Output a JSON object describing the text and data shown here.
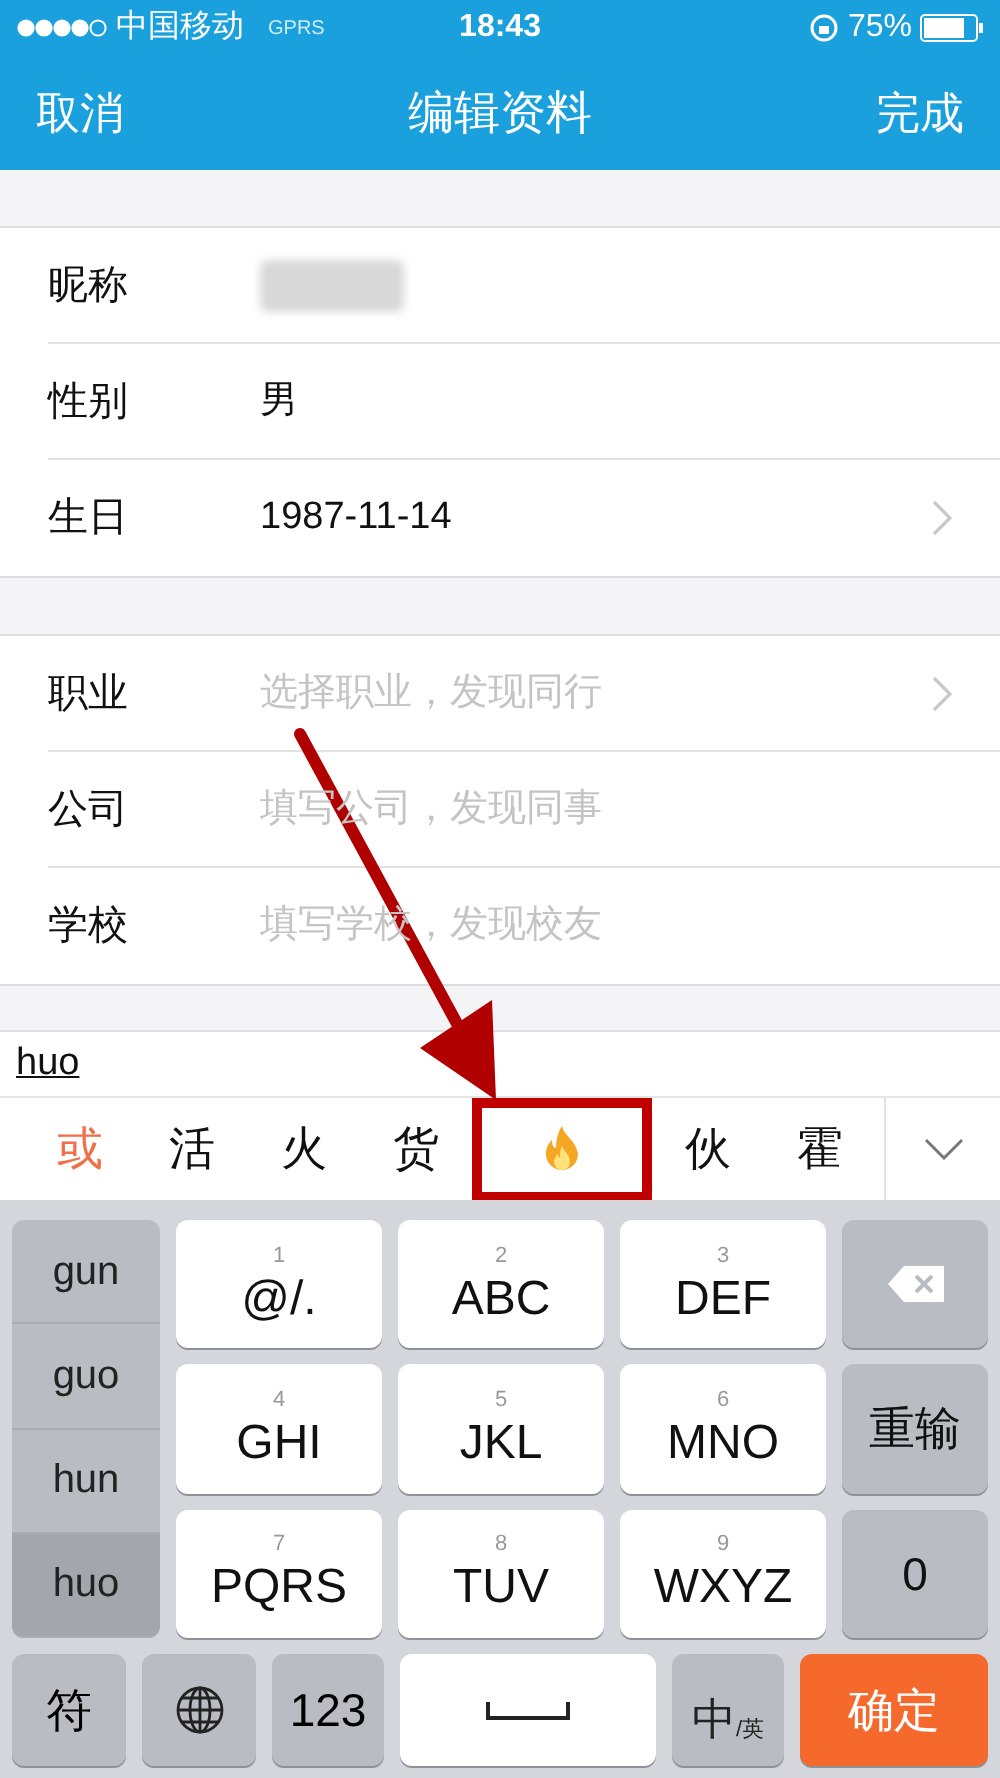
{
  "status_bar": {
    "carrier": "中国移动",
    "network": "GPRS",
    "time": "18:43",
    "battery": "75%"
  },
  "nav": {
    "left": "取消",
    "title": "编辑资料",
    "right": "完成"
  },
  "sections": [
    {
      "rows": [
        {
          "label": "昵称",
          "kind": "blurred",
          "chevron": false
        },
        {
          "label": "性别",
          "value": "男",
          "kind": "value",
          "chevron": false
        },
        {
          "label": "生日",
          "value": "1987-11-14",
          "kind": "value",
          "chevron": true
        }
      ]
    },
    {
      "rows": [
        {
          "label": "职业",
          "placeholder": "选择职业，发现同行",
          "kind": "field",
          "chevron": true
        },
        {
          "label": "公司",
          "placeholder": "填写公司，发现同事",
          "kind": "field",
          "chevron": false
        },
        {
          "label": "学校",
          "placeholder": "填写学校，发现校友",
          "kind": "field",
          "chevron": false
        }
      ]
    }
  ],
  "ime": {
    "composition": "huo",
    "candidates": [
      {
        "text": "或",
        "selected": true,
        "highlighted": false,
        "kind": "text"
      },
      {
        "text": "活",
        "selected": false,
        "highlighted": false,
        "kind": "text"
      },
      {
        "text": "火",
        "selected": false,
        "highlighted": false,
        "kind": "text"
      },
      {
        "text": "货",
        "selected": false,
        "highlighted": false,
        "kind": "text"
      },
      {
        "kind": "emoji",
        "selected": false,
        "highlighted": true
      },
      {
        "text": "伙",
        "selected": false,
        "highlighted": false,
        "kind": "text"
      },
      {
        "text": "霍",
        "selected": false,
        "highlighted": false,
        "kind": "text"
      }
    ]
  },
  "keyboard": {
    "pinyin": [
      {
        "text": "gun",
        "selected": false
      },
      {
        "text": "guo",
        "selected": false
      },
      {
        "text": "hun",
        "selected": false
      },
      {
        "text": "huo",
        "selected": true
      }
    ],
    "keys": [
      {
        "digit": "1",
        "letters": "@/."
      },
      {
        "digit": "2",
        "letters": "ABC"
      },
      {
        "digit": "3",
        "letters": "DEF"
      },
      {
        "digit": "4",
        "letters": "GHI"
      },
      {
        "digit": "5",
        "letters": "JKL"
      },
      {
        "digit": "6",
        "letters": "MNO"
      },
      {
        "digit": "7",
        "letters": "PQRS"
      },
      {
        "digit": "8",
        "letters": "TUV"
      },
      {
        "digit": "9",
        "letters": "WXYZ"
      }
    ],
    "side_keys": [
      {
        "kind": "delete"
      },
      {
        "kind": "text",
        "text": "重输"
      },
      {
        "kind": "text",
        "text": "0"
      }
    ],
    "bottom": {
      "symbols": "符",
      "numbers": "123",
      "lang_main": "中",
      "lang_sub": "/英",
      "confirm": "确定"
    }
  }
}
